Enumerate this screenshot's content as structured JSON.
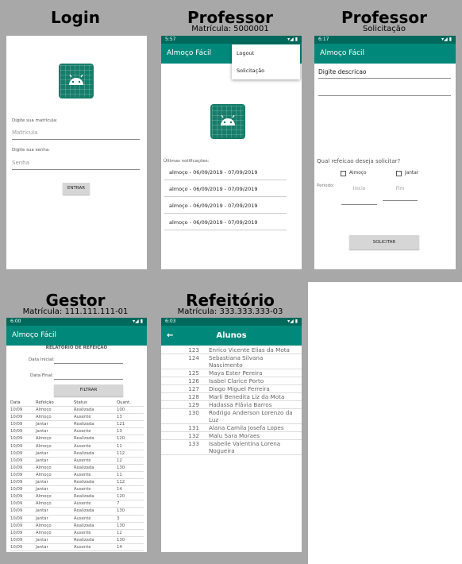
{
  "screens": {
    "login": {
      "title": "Login",
      "matricula_label": "Digite sua matrícula:",
      "matricula_placeholder": "Matrícula",
      "senha_label": "Digite sua senha:",
      "senha_placeholder": "Senha",
      "button": "ENTRAR"
    },
    "professor1": {
      "title": "Professor",
      "subtitle": "Matrícula: 5000001",
      "time": "5:57",
      "app_title": "Almoço Fácil",
      "menu": [
        "Logout",
        "Solicitação"
      ],
      "notif_label": "Últimas notificações:",
      "notifications": [
        "almoço - 06/09/2019 - 07/09/2019",
        "almoço - 06/09/2019 - 07/09/2019",
        "almoço - 06/09/2019 - 07/09/2019",
        "almoço - 06/09/2019 - 07/09/2019"
      ]
    },
    "professor2": {
      "title": "Professor",
      "subtitle": "Solicitação",
      "time": "6:17",
      "app_title": "Almoço Fácil",
      "descricao": "Digite descricao",
      "question": "Qual refeicao deseja solicitar?",
      "opt_almoco": "Almoço",
      "opt_jantar": "Jantar",
      "periodo": "Periodo:",
      "inicio": "Inicio",
      "fim": "Fim",
      "button": "SOLICITAR"
    },
    "gestor": {
      "title": "Gestor",
      "subtitle": "Matrícula: 111.111.111-01",
      "time": "6:00",
      "app_title": "Almoço Fácil",
      "report_title": "RELATÓRIO DE REFEIÇÃO",
      "data_inicial": "Data Inicial:",
      "data_final": "Data Final:",
      "button": "FILTRAR",
      "headers": [
        "Data",
        "Refeição",
        "Status",
        "Quant."
      ],
      "rows": [
        [
          "10/09",
          "Almoço",
          "Realizada",
          "100"
        ],
        [
          "10/09",
          "Almoço",
          "Ausente",
          "13"
        ],
        [
          "10/09",
          "Jantar",
          "Realizada",
          "121"
        ],
        [
          "10/09",
          "Jantar",
          "Ausente",
          "13"
        ],
        [
          "10/09",
          "Almoço",
          "Realizada",
          "120"
        ],
        [
          "10/09",
          "Almoço",
          "Ausente",
          "11"
        ],
        [
          "10/09",
          "Jantar",
          "Realizada",
          "112"
        ],
        [
          "10/09",
          "Jantar",
          "Ausente",
          "12"
        ],
        [
          "10/09",
          "Almoço",
          "Realizada",
          "130"
        ],
        [
          "10/09",
          "Almoço",
          "Ausente",
          "11"
        ],
        [
          "10/09",
          "Jantar",
          "Realizada",
          "112"
        ],
        [
          "10/09",
          "Jantar",
          "Ausente",
          "14"
        ],
        [
          "10/09",
          "Almoço",
          "Realizada",
          "120"
        ],
        [
          "10/09",
          "Almoço",
          "Ausente",
          "7"
        ],
        [
          "10/09",
          "Jantar",
          "Realizada",
          "130"
        ],
        [
          "10/09",
          "Jantar",
          "Ausente",
          "3"
        ],
        [
          "10/09",
          "Almoço",
          "Realizada",
          "130"
        ],
        [
          "10/09",
          "Almoço",
          "Ausente",
          "12"
        ],
        [
          "10/09",
          "Jantar",
          "Realizada",
          "130"
        ],
        [
          "10/09",
          "Jantar",
          "Ausente",
          "14"
        ]
      ]
    },
    "refeitorio": {
      "title": "Refeitório",
      "subtitle": "Matrícula: 333.333.333-03",
      "time": "6:03",
      "app_title": "Alunos",
      "students": [
        [
          "123",
          "Enrico Vicente Elias da Mota"
        ],
        [
          "124",
          "Sebastiana Silvana Nascimento"
        ],
        [
          "125",
          "Maya Ester Pereira"
        ],
        [
          "126",
          "Isabel Clarice Porto"
        ],
        [
          "127",
          "Diogo Miguel Ferreira"
        ],
        [
          "128",
          "Marli Benedita Liz da Mota"
        ],
        [
          "129",
          "Hadassa Flávia Barros"
        ],
        [
          "130",
          "Rodrigo Anderson Lorenzo da Luz"
        ],
        [
          "131",
          "Alana Camila Josefa Lopes"
        ],
        [
          "132",
          "Malu Sara Moraes"
        ],
        [
          "133",
          "Isabelle Valentina Lorena Nogueira"
        ]
      ]
    }
  },
  "colors": {
    "appbar": "#00897b",
    "statusbar": "#00695c",
    "icon": "#167d6a"
  }
}
